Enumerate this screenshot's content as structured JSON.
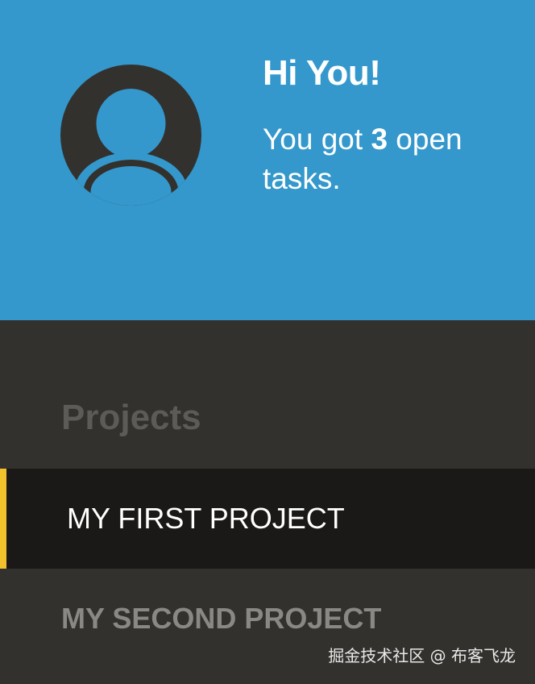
{
  "header": {
    "background_color": "#3498cc",
    "avatar_icon": "user-avatar-icon",
    "greeting": "Hi You!",
    "status_prefix": "You got ",
    "open_task_count": "3",
    "status_suffix": " open tasks."
  },
  "projects": {
    "heading": "Projects",
    "accent_color": "#f2c22c",
    "items": [
      {
        "label": "MY FIRST PROJECT",
        "active": true
      },
      {
        "label": "MY SECOND PROJECT",
        "active": false
      }
    ]
  },
  "watermark": "掘金技术社区 @ 布客飞龙"
}
